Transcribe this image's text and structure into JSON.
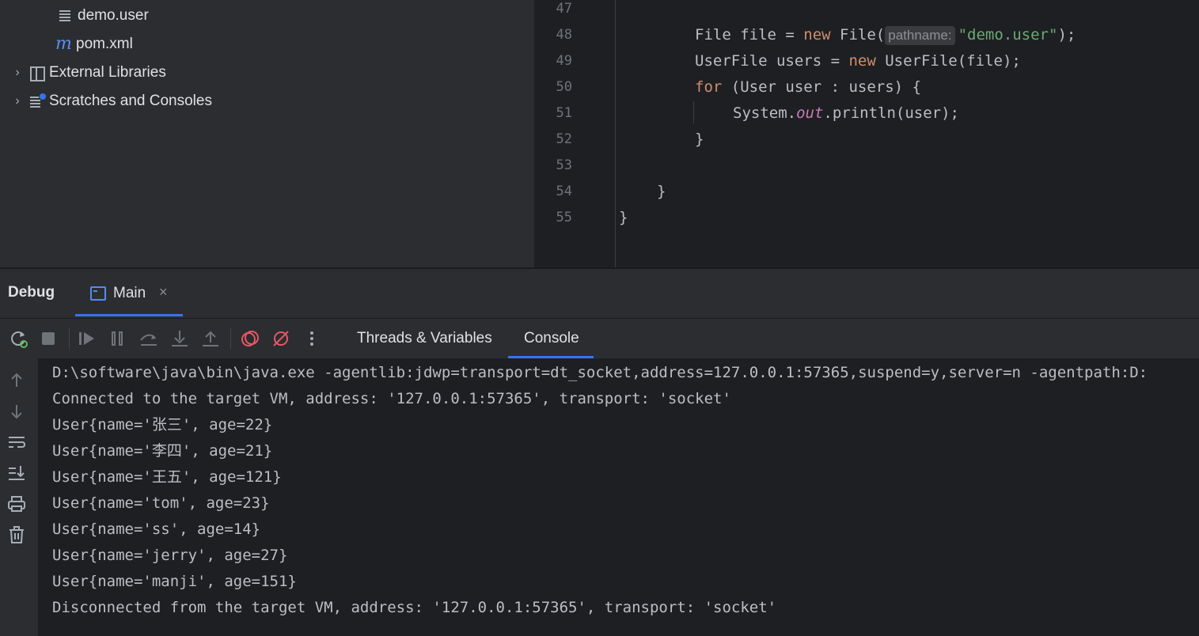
{
  "project_tree": {
    "items": [
      {
        "label": "demo.user",
        "icon": "text-file-icon",
        "expandable": false
      },
      {
        "label": "pom.xml",
        "icon": "maven-icon",
        "expandable": false
      },
      {
        "label": "External Libraries",
        "icon": "libraries-icon",
        "expandable": true
      },
      {
        "label": "Scratches and Consoles",
        "icon": "scratches-icon",
        "expandable": true
      }
    ]
  },
  "editor": {
    "line_numbers": [
      "47",
      "48",
      "49",
      "50",
      "51",
      "52",
      "53",
      "54",
      "55"
    ],
    "lines": {
      "l48": {
        "t1": "File file = ",
        "kw1": "new",
        "t2": " File(",
        "hint": "pathname:",
        "str": "\"demo.user\"",
        "t3": ");"
      },
      "l49": {
        "t1": "UserFile users = ",
        "kw1": "new",
        "t2": " UserFile(file);"
      },
      "l50": {
        "kw1": "for",
        "t1": " (User user : users) {"
      },
      "l51": {
        "t1": "System.",
        "field": "out",
        "t2": ".println(user);"
      },
      "l52": {
        "t1": "}"
      },
      "l54": {
        "t1": "}"
      },
      "l55": {
        "t1": "}"
      }
    }
  },
  "debug": {
    "title": "Debug",
    "tab": {
      "label": "Main",
      "close": "×"
    },
    "sub_tabs": {
      "threads": "Threads & Variables",
      "console": "Console"
    },
    "toolbar_icons": [
      "rerun-icon",
      "stop-icon",
      "resume-icon",
      "pause-icon",
      "step-over-icon",
      "step-into-icon",
      "step-out-icon",
      "view-breakpoints-icon",
      "mute-breakpoints-icon",
      "more-icon"
    ],
    "side_icons": [
      "up-arrow-icon",
      "down-arrow-icon",
      "soft-wrap-icon",
      "scroll-to-end-icon",
      "print-icon",
      "clear-icon"
    ]
  },
  "console": {
    "lines": [
      "D:\\software\\java\\bin\\java.exe -agentlib:jdwp=transport=dt_socket,address=127.0.0.1:57365,suspend=y,server=n -agentpath:D:",
      "Connected to the target VM, address: '127.0.0.1:57365', transport: 'socket'",
      "User{name='张三', age=22}",
      "User{name='李四', age=21}",
      "User{name='王五', age=121}",
      "User{name='tom', age=23}",
      "User{name='ss', age=14}",
      "User{name='jerry', age=27}",
      "User{name='manji', age=151}",
      "Disconnected from the target VM, address: '127.0.0.1:57365', transport: 'socket'"
    ]
  },
  "colors": {
    "accent": "#3574f0",
    "keyword": "#cf8e6d",
    "string": "#6aab73",
    "field": "#c77dbb"
  }
}
